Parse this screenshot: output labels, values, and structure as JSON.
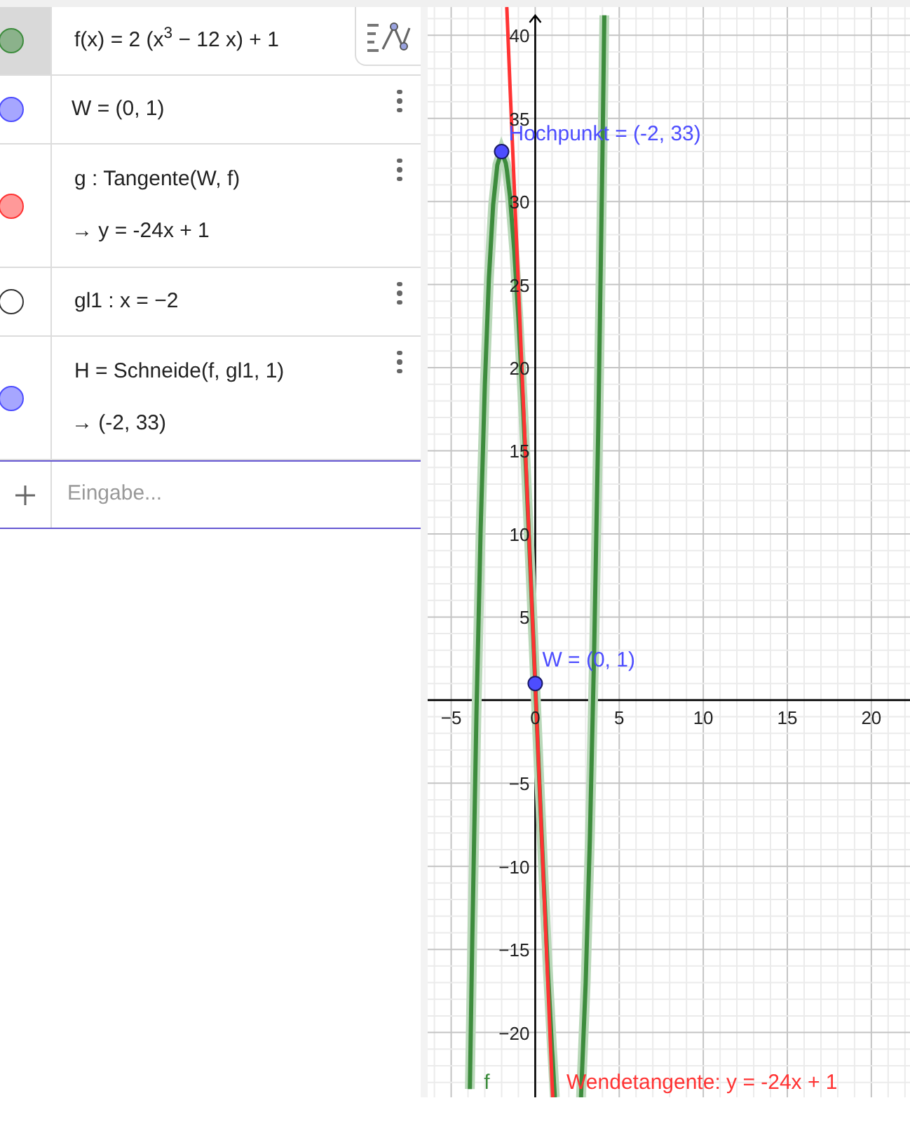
{
  "algebra": {
    "rows": [
      {
        "color": "#3d8c3d",
        "visible": true,
        "selected": true,
        "lines": [
          "f(x) = 2 (x$^{3}$ − 12 x) + 1"
        ]
      },
      {
        "color": "#4d4dff",
        "visible": true,
        "selected": false,
        "lines": [
          "W = (0, 1)"
        ]
      },
      {
        "color": "#ff3333",
        "visible": true,
        "selected": false,
        "lines": [
          "g : Tangente(W, f)",
          "→  y = -24x + 1"
        ]
      },
      {
        "color": "#333333",
        "visible": false,
        "selected": false,
        "lines": [
          "gl1 : x = −2"
        ]
      },
      {
        "color": "#4d4dff",
        "visible": true,
        "selected": false,
        "lines": [
          "H = Schneide(f, gl1, 1)",
          "→  (-2, 33)"
        ]
      }
    ],
    "input": {
      "placeholder": "Eingabe..."
    }
  },
  "graphics": {
    "chart_data": {
      "type": "line",
      "grid": true,
      "xlim": [
        -6.4,
        22.3
      ],
      "ylim": [
        -23.9,
        41.7
      ],
      "xticks": [
        -5,
        0,
        5,
        10,
        15,
        20
      ],
      "yticks": [
        -20,
        -15,
        -10,
        -5,
        5,
        10,
        15,
        20,
        25,
        30,
        35,
        40
      ],
      "x": [
        -3.89,
        -3.75,
        -3.5,
        -3.25,
        -3,
        -2.75,
        -2.5,
        -2.25,
        -2,
        -1.75,
        -1.69,
        -1.5,
        -1.25,
        -1,
        -0.75,
        -0.5,
        -0.25,
        0,
        0.25,
        0.5,
        0.75,
        1,
        1.03,
        1.15,
        2,
        2.73,
        3,
        3.25,
        3.5,
        3.75,
        4,
        4.11
      ],
      "series": [
        {
          "name": "f",
          "color": "#3d8c3d",
          "values": [
            -23.4,
            -14.5,
            -0.8,
            10.3,
            19,
            25.4,
            29.8,
            32.2,
            33,
            32.3,
            31.9,
            30.3,
            27.1,
            23,
            18.2,
            12.8,
            7,
            1,
            -5,
            -10.8,
            -16.2,
            -21,
            -21.5,
            -23.6,
            null,
            -23.8,
            -17,
            -8.3,
            2.8,
            16.5,
            33,
            41.2
          ]
        },
        {
          "name": "Wendetangente: y = -24x + 1",
          "color": "#ff3333",
          "values": [
            null,
            null,
            null,
            null,
            null,
            null,
            null,
            null,
            null,
            null,
            41.6,
            37,
            31,
            25,
            19,
            13,
            7,
            1,
            -5,
            -11,
            -17,
            -23,
            -23.7,
            null,
            null,
            null,
            null,
            null,
            null,
            null,
            null,
            null
          ]
        }
      ],
      "annotations": [
        {
          "text": "Hochpunkt = (-2, 33)",
          "x": -2,
          "y": 33
        },
        {
          "text": "W = (0, 1)",
          "x": 0,
          "y": 1
        }
      ]
    }
  }
}
